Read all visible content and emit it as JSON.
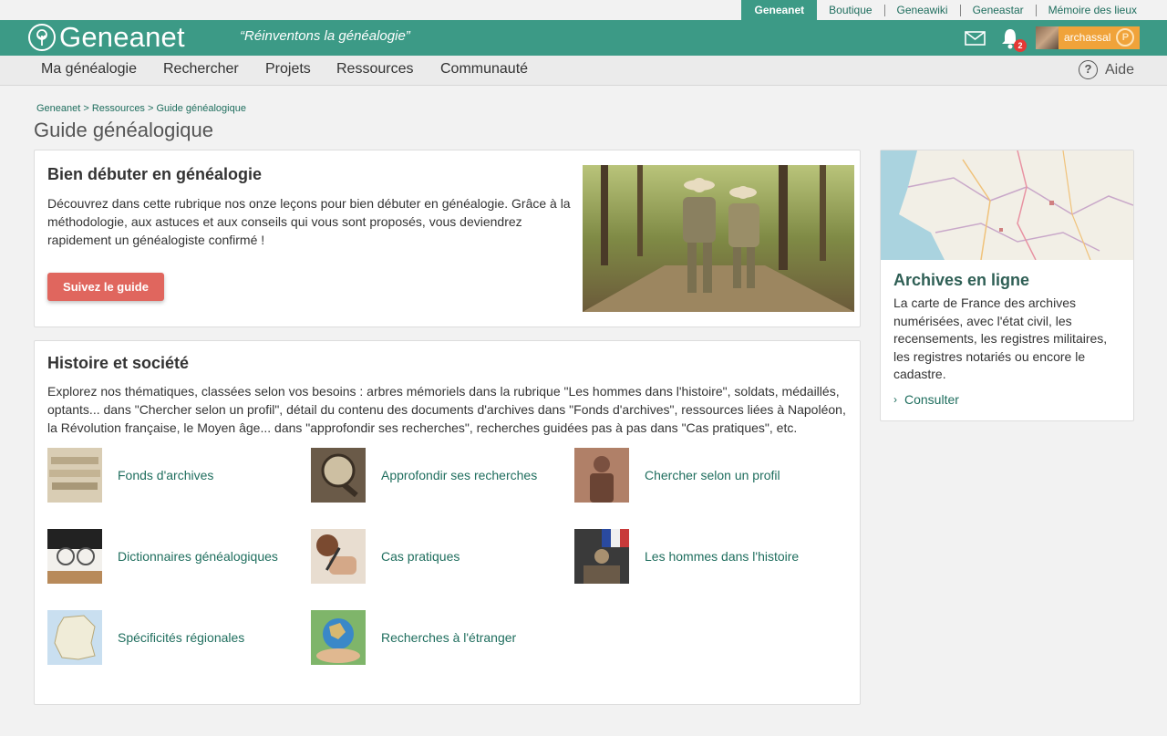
{
  "network": {
    "links": [
      "Geneanet",
      "Boutique",
      "Geneawiki",
      "Geneastar",
      "Mémoire des lieux"
    ],
    "active": "Geneanet"
  },
  "header": {
    "logo_text": "Geneanet",
    "slogan": "“Réinventons la généalogie”",
    "notification_count": "2",
    "username": "archassal",
    "premium_badge": "P",
    "icons": [
      "mail-icon",
      "bell-icon",
      "avatar",
      "premium-icon",
      "tree-logo-icon"
    ]
  },
  "nav": {
    "items": [
      "Ma généalogie",
      "Rechercher",
      "Projets",
      "Ressources",
      "Communauté"
    ],
    "help": "Aide"
  },
  "breadcrumb": "Geneanet > Ressources > Guide généalogique",
  "page_title": "Guide généalogique",
  "guide": {
    "title": "Bien débuter en généalogie",
    "description": "Découvrez dans cette rubrique nos onze leçons pour bien débuter en généalogie. Grâce à la méthodologie, aux astuces et aux conseils qui vous sont proposés, vous deviendrez rapidement un généalogiste confirmé !",
    "button": "Suivez le guide"
  },
  "history": {
    "title": "Histoire et société",
    "description": "Explorez nos thématiques, classées selon vos besoins : arbres mémoriels dans la rubrique \"Les hommes dans l'histoire\", soldats, médaillés, optants... dans \"Chercher selon un profil\", détail du contenu des documents d'archives dans \"Fonds d'archives\", ressources liées à Napoléon, la Révolution française, le Moyen âge... dans \"approfondir ses recherches\", recherches guidées pas à pas dans \"Cas pratiques\", etc.",
    "topics": [
      "Fonds d'archives",
      "Approfondir ses recherches",
      "Chercher selon un profil",
      "Dictionnaires généalogiques",
      "Cas pratiques",
      "Les hommes dans l'histoire",
      "Spécificités régionales",
      "Recherches à l'étranger"
    ]
  },
  "archives": {
    "title": "Archives en ligne",
    "description": "La carte de France des archives numérisées, avec l'état civil, les recensements, les registres militaires, les registres notariés ou encore le cadastre.",
    "link": "Consulter"
  },
  "colors": {
    "brand": "#3c9a86",
    "link": "#1f6e5e",
    "button": "#e0665e",
    "user_badge": "#f0a33a"
  }
}
